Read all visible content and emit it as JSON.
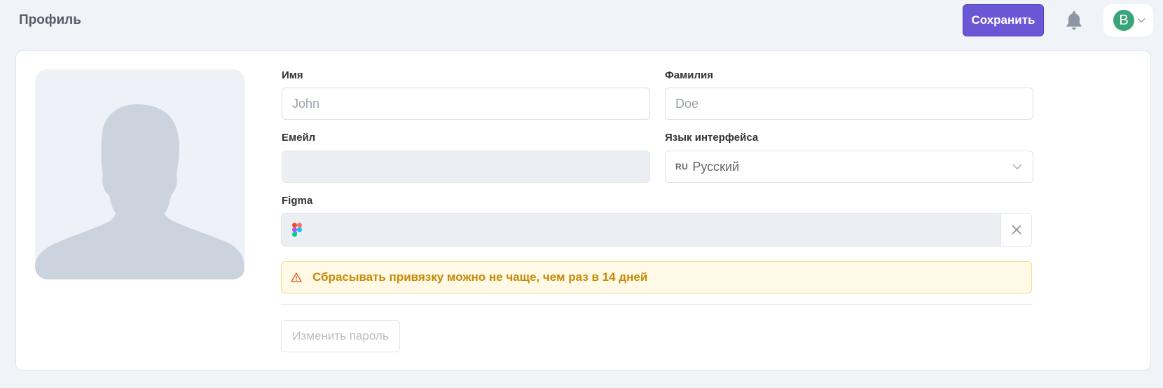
{
  "header": {
    "title": "Профиль",
    "save_label": "Сохранить",
    "user_initial": "B",
    "accent_color": "#6b57d6",
    "avatar_color": "#3aa57a"
  },
  "profile": {
    "first_name": {
      "label": "Имя",
      "placeholder": "John",
      "value": ""
    },
    "last_name": {
      "label": "Фамилия",
      "placeholder": "Doe",
      "value": ""
    },
    "email": {
      "label": "Емейл",
      "value": ""
    },
    "language": {
      "label": "Язык интерфейса",
      "flag": "RU",
      "value": "Русский"
    },
    "figma": {
      "label": "Figma",
      "value": ""
    },
    "warning": "Сбрасывать привязку можно не чаще, чем раз в 14 дней",
    "change_password_label": "Изменить пароль"
  },
  "icons": {
    "bell": "bell-icon",
    "chevron": "chevron-down-icon",
    "figma": "figma-logo-icon",
    "close": "close-icon",
    "warning": "warning-icon",
    "avatar_placeholder": "person-silhouette-icon"
  }
}
